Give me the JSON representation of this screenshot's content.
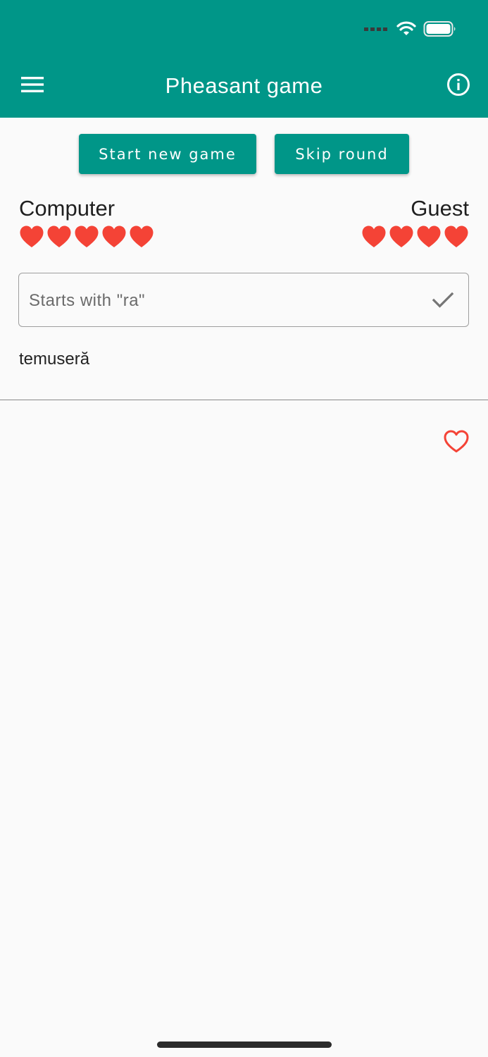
{
  "colors": {
    "primary": "#009688",
    "heart": "#f44336",
    "on_primary": "#ffffff"
  },
  "status_bar": {
    "icons": [
      "cellular-signal-icon",
      "wifi-icon",
      "battery-icon"
    ]
  },
  "app_bar": {
    "title": "Pheasant game",
    "left_icon": "menu-icon",
    "right_icon": "info-icon"
  },
  "actions": {
    "start_label": "Start new game",
    "skip_label": "Skip round"
  },
  "players": {
    "left": {
      "name": "Computer",
      "lives": 5
    },
    "right": {
      "name": "Guest",
      "lives": 4
    }
  },
  "word_input": {
    "placeholder": "Starts with \"ra\"",
    "value": "",
    "submit_icon": "check-icon"
  },
  "last_word": "temuseră",
  "favorite": {
    "icon": "heart-outline-icon"
  }
}
